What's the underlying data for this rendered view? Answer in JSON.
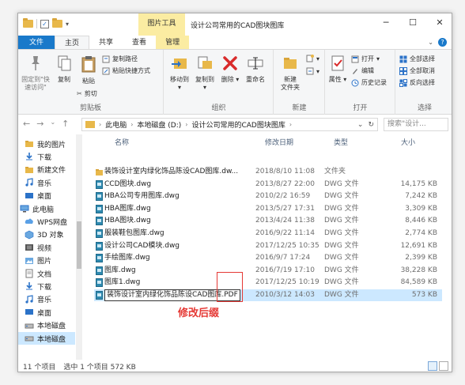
{
  "window": {
    "title": "设计公司常用的CAD图块图库"
  },
  "ribbon_tabs": {
    "file": "文件",
    "home": "主页",
    "share": "共享",
    "view": "查看",
    "manage": "管理",
    "context_header": "图片工具"
  },
  "ribbon": {
    "clipboard": {
      "label": "剪贴板",
      "pin": "固定到\"快\n速访问\"",
      "copy": "复制",
      "paste": "粘贴",
      "copy_path": "复制路径",
      "paste_shortcut": "粘贴快捷方式",
      "cut": "剪切"
    },
    "organize": {
      "label": "组织",
      "move_to": "移动到",
      "copy_to": "复制到",
      "delete": "删除",
      "rename": "重命名"
    },
    "new": {
      "label": "新建",
      "new_folder": "新建\n文件夹"
    },
    "open": {
      "label": "打开",
      "properties": "属性",
      "open": "打开",
      "edit": "编辑",
      "history": "历史记录"
    },
    "select": {
      "label": "选择",
      "select_all": "全部选择",
      "select_none": "全部取消",
      "invert": "反向选择"
    }
  },
  "address": {
    "crumbs": [
      "此电脑",
      "本地磁盘 (D:)",
      "设计公司常用的CAD图块图库"
    ],
    "search_placeholder": "搜索\"设计..."
  },
  "nav_items": [
    {
      "label": "我的图片",
      "icon": "folder"
    },
    {
      "label": "下载",
      "icon": "download"
    },
    {
      "label": "新建文件",
      "icon": "folder"
    },
    {
      "label": "音乐",
      "icon": "music"
    },
    {
      "label": "桌面",
      "icon": "desktop"
    },
    {
      "label": "此电脑",
      "icon": "pc"
    },
    {
      "label": "WPS网盘",
      "icon": "cloud"
    },
    {
      "label": "3D 对象",
      "icon": "cube"
    },
    {
      "label": "视频",
      "icon": "video"
    },
    {
      "label": "图片",
      "icon": "picture"
    },
    {
      "label": "文档",
      "icon": "document"
    },
    {
      "label": "下载",
      "icon": "download"
    },
    {
      "label": "音乐",
      "icon": "music"
    },
    {
      "label": "桌面",
      "icon": "desktop"
    },
    {
      "label": "本地磁盘",
      "icon": "drive"
    },
    {
      "label": "本地磁盘",
      "icon": "drive"
    }
  ],
  "columns": {
    "name": "名称",
    "date": "修改日期",
    "type": "类型",
    "size": "大小"
  },
  "files": [
    {
      "name": "装饰设计室内绿化饰品陈设CAD图库.dw...",
      "date": "2018/8/10 11:08",
      "type": "文件夹",
      "size": "",
      "icon": "folder"
    },
    {
      "name": "CCD图块.dwg",
      "date": "2013/8/27 22:00",
      "type": "DWG 文件",
      "size": "14,175 KB",
      "icon": "dwg"
    },
    {
      "name": "HBA公司专用图库.dwg",
      "date": "2010/2/2 16:59",
      "type": "DWG 文件",
      "size": "7,242 KB",
      "icon": "dwg"
    },
    {
      "name": "HBA图库.dwg",
      "date": "2013/5/27 17:31",
      "type": "DWG 文件",
      "size": "3,309 KB",
      "icon": "dwg"
    },
    {
      "name": "HBA图块.dwg",
      "date": "2013/4/24 11:38",
      "type": "DWG 文件",
      "size": "8,446 KB",
      "icon": "dwg"
    },
    {
      "name": "服装鞋包图库.dwg",
      "date": "2016/9/22 11:14",
      "type": "DWG 文件",
      "size": "2,774 KB",
      "icon": "dwg"
    },
    {
      "name": "设计公司CAD模块.dwg",
      "date": "2017/12/25 10:35",
      "type": "DWG 文件",
      "size": "12,691 KB",
      "icon": "dwg"
    },
    {
      "name": "手绘图库.dwg",
      "date": "2016/9/7 17:24",
      "type": "DWG 文件",
      "size": "2,399 KB",
      "icon": "dwg"
    },
    {
      "name": "图库.dwg",
      "date": "2016/7/19 17:10",
      "type": "DWG 文件",
      "size": "38,228 KB",
      "icon": "dwg"
    },
    {
      "name": "图库1.dwg",
      "date": "2017/12/25 10:19",
      "type": "DWG 文件",
      "size": "84,589 KB",
      "icon": "dwg"
    },
    {
      "name": "装饰设计室内绿化饰品陈设CAD图库.PDF",
      "date": "2010/3/12 14:03",
      "type": "DWG 文件",
      "size": "573 KB",
      "icon": "dwg",
      "renaming": true
    }
  ],
  "annotation": "修改后缀",
  "status": {
    "count": "11 个项目",
    "selected": "选中 1 个项目  572 KB"
  },
  "colors": {
    "accent": "#1979ca",
    "selection": "#cce8ff",
    "context": "#fbeca2",
    "annotation": "#e53935"
  }
}
